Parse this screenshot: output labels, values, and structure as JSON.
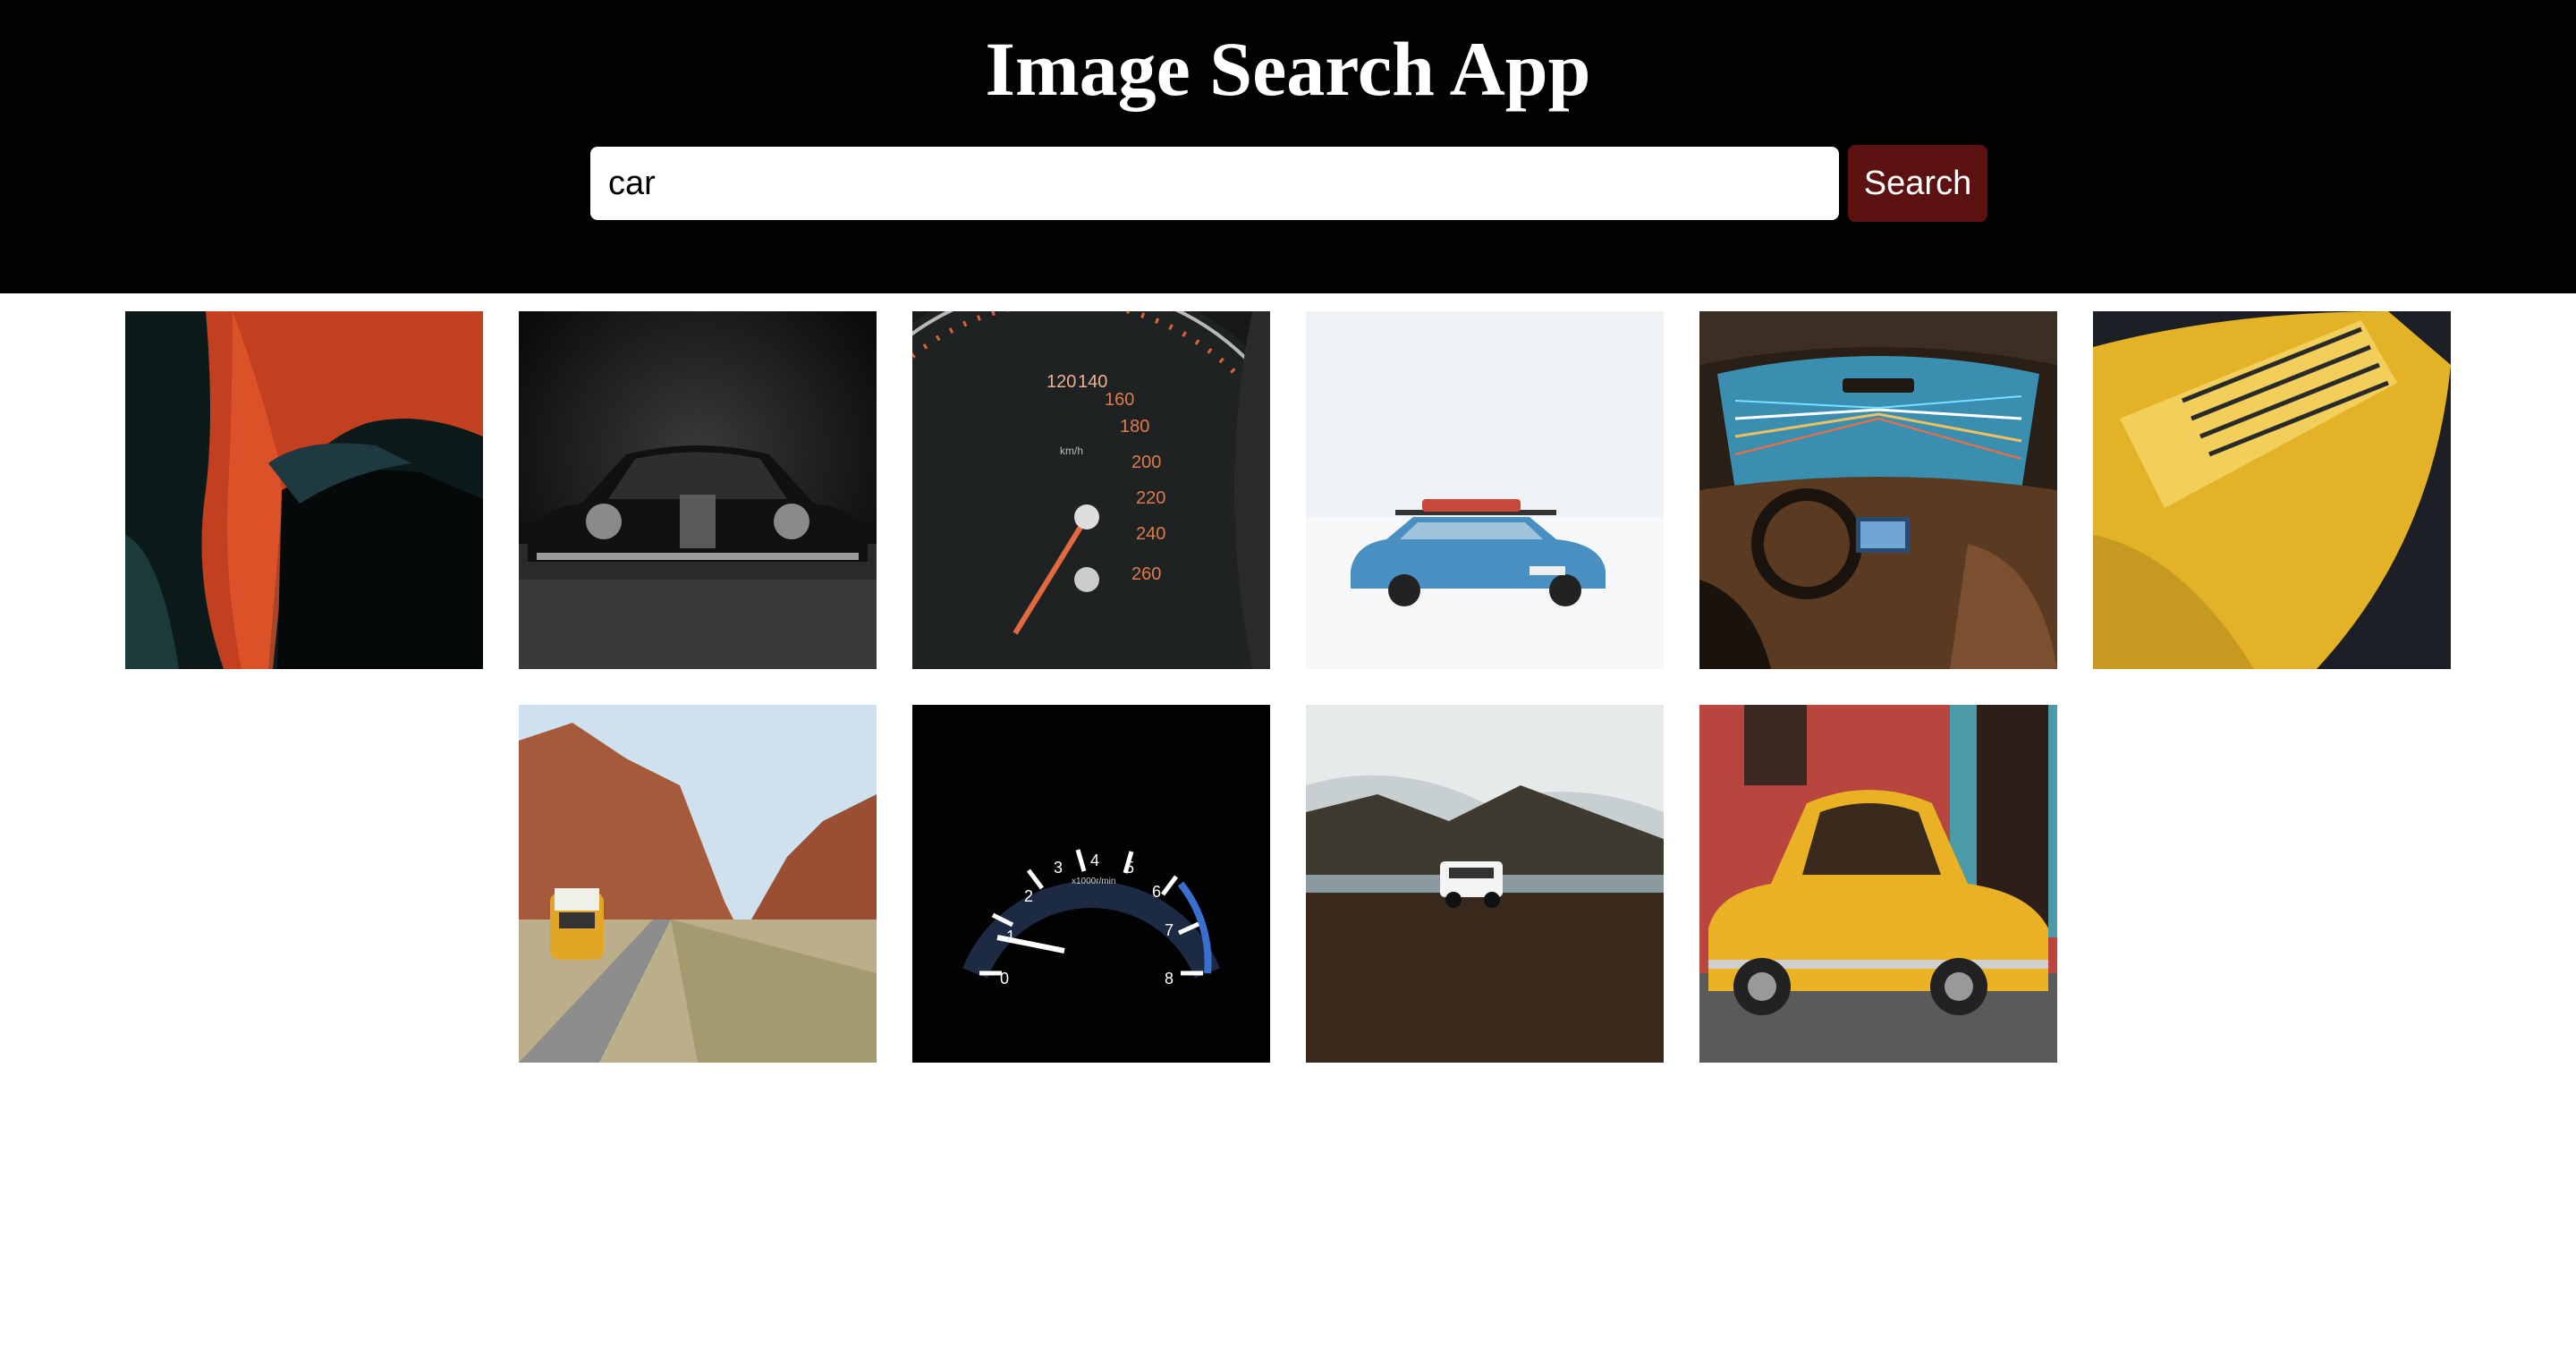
{
  "header": {
    "title": "Image Search App"
  },
  "search": {
    "value": "car",
    "button_label": "Search"
  },
  "results": [
    {
      "subject": "red car headlight close-up"
    },
    {
      "subject": "vintage black car front"
    },
    {
      "subject": "speedometer orange needle"
    },
    {
      "subject": "blue car in snow with roof rack"
    },
    {
      "subject": "car interior with light trails"
    },
    {
      "subject": "yellow Porsche rear"
    },
    {
      "subject": "yellow van on desert road"
    },
    {
      "subject": "illuminated tachometer dashboard"
    },
    {
      "subject": "white SUV by lake and mountains"
    },
    {
      "subject": "yellow vintage car on street"
    }
  ],
  "gauge_labels": {
    "speedo": [
      "120",
      "140",
      "160",
      "180",
      "200",
      "220",
      "240",
      "260"
    ],
    "speedo_unit": "km/h",
    "tacho": [
      "0",
      "1",
      "2",
      "3",
      "4",
      "5",
      "6",
      "7",
      "8"
    ],
    "tacho_unit": "x1000r/min"
  },
  "colors": {
    "header_bg": "#040101",
    "button_bg": "#5d1212",
    "text_light": "#ffffff"
  }
}
